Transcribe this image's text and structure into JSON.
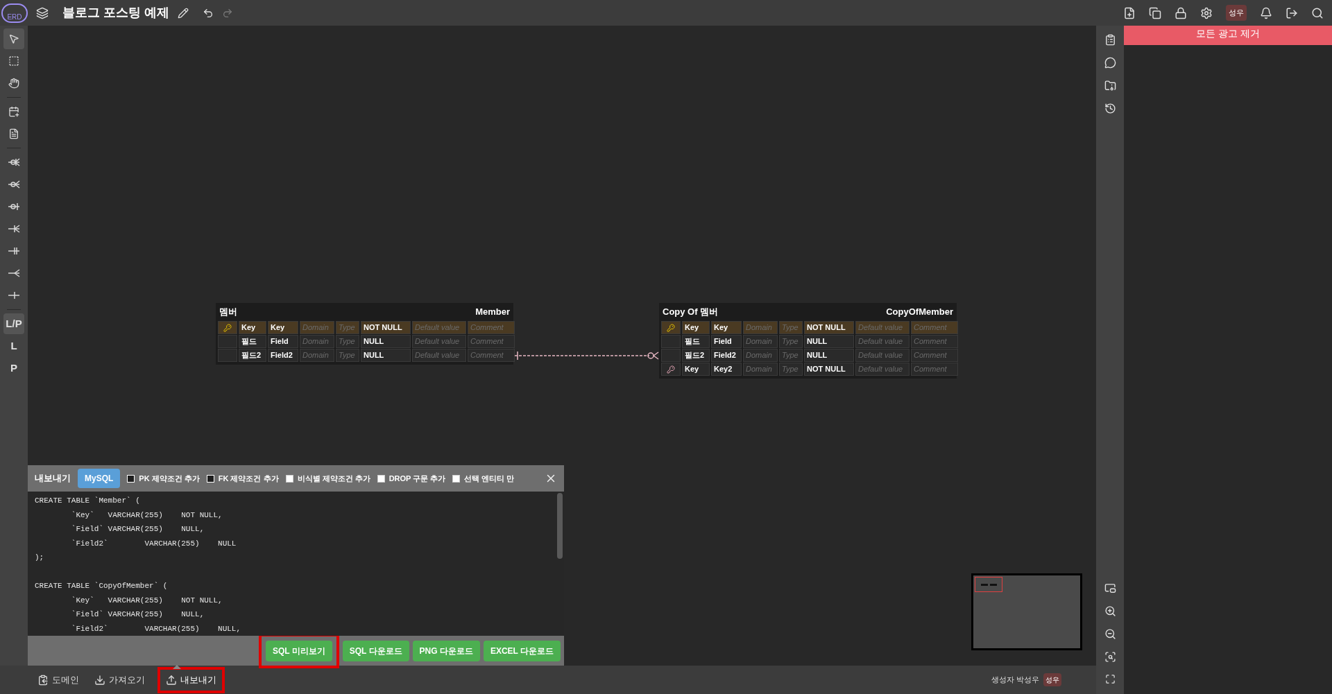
{
  "top_bar": {
    "logo": "ERD",
    "title": "블로그 포스팅 예제",
    "avatar": "성우"
  },
  "left_toolbar": [
    {
      "kind": "icon",
      "selected": true
    },
    {
      "kind": "icon",
      "selected": false
    },
    {
      "kind": "icon",
      "selected": false
    },
    {
      "kind": "icon",
      "selected": false
    },
    {
      "kind": "icon",
      "selected": false
    },
    {
      "kind": "icon",
      "selected": false
    },
    {
      "kind": "icon",
      "selected": false
    },
    {
      "kind": "icon",
      "selected": false
    },
    {
      "kind": "icon",
      "selected": false
    },
    {
      "kind": "icon",
      "selected": false
    },
    {
      "kind": "icon",
      "selected": false
    },
    {
      "kind": "icon",
      "selected": false
    },
    {
      "kind": "text",
      "label": "L/P",
      "selected": true
    },
    {
      "kind": "text",
      "label": "L",
      "selected": false
    },
    {
      "kind": "text",
      "label": "P",
      "selected": false
    }
  ],
  "tables": [
    {
      "logical_name": "멤버",
      "physical_name": "Member",
      "rows": [
        {
          "kind": "pk",
          "logical": "Key",
          "physical": "Key",
          "domain": "Domain",
          "type": "Type",
          "null": "NOT NULL",
          "default": "Default value",
          "comment": "Comment"
        },
        {
          "kind": "field",
          "logical": "필드",
          "physical": "Field",
          "domain": "Domain",
          "type": "Type",
          "null": "NULL",
          "default": "Default value",
          "comment": "Comment"
        },
        {
          "kind": "field",
          "logical": "필드2",
          "physical": "Field2",
          "domain": "Domain",
          "type": "Type",
          "null": "NULL",
          "default": "Default value",
          "comment": "Comment"
        }
      ]
    },
    {
      "logical_name": "Copy Of 멤버",
      "physical_name": "CopyOfMember",
      "rows": [
        {
          "kind": "pk",
          "logical": "Key",
          "physical": "Key",
          "domain": "Domain",
          "type": "Type",
          "null": "NOT NULL",
          "default": "Default value",
          "comment": "Comment"
        },
        {
          "kind": "field",
          "logical": "필드",
          "physical": "Field",
          "domain": "Domain",
          "type": "Type",
          "null": "NULL",
          "default": "Default value",
          "comment": "Comment"
        },
        {
          "kind": "field",
          "logical": "필드2",
          "physical": "Field2",
          "domain": "Domain",
          "type": "Type",
          "null": "NULL",
          "default": "Default value",
          "comment": "Comment"
        },
        {
          "kind": "fk",
          "logical": "Key",
          "physical": "Key2",
          "domain": "Domain",
          "type": "Type",
          "null": "NOT NULL",
          "default": "Default value",
          "comment": "Comment"
        }
      ]
    }
  ],
  "export_panel": {
    "title": "내보내기",
    "dialect": "MySQL",
    "options": [
      {
        "label": "PK 제약조건 추가",
        "checked": true
      },
      {
        "label": "FK 제약조건 추가",
        "checked": true
      },
      {
        "label": "비식별 제약조건 추가",
        "checked": false
      },
      {
        "label": "DROP 구문 추가",
        "checked": false
      },
      {
        "label": "선택 엔티티 만",
        "checked": false
      }
    ],
    "code_blocks": [
      [
        "CREATE TABLE `Member` (",
        "        `Key`   VARCHAR(255)    NOT NULL,",
        "        `Field` VARCHAR(255)    NULL,",
        "        `Field2`        VARCHAR(255)    NULL",
        ");"
      ],
      [
        "CREATE TABLE `CopyOfMember` (",
        "        `Key`   VARCHAR(255)    NOT NULL,",
        "        `Field` VARCHAR(255)    NULL,",
        "        `Field2`        VARCHAR(255)    NULL,"
      ]
    ],
    "buttons": [
      {
        "label": "SQL 미리보기",
        "highlighted": true
      },
      {
        "label": "SQL 다운로드",
        "highlighted": false
      },
      {
        "label": "PNG 다운로드",
        "highlighted": false
      },
      {
        "label": "EXCEL 다운로드",
        "highlighted": false
      }
    ]
  },
  "bottom_bar": {
    "tabs": [
      {
        "label": "도메인",
        "selected": false,
        "highlighted": false
      },
      {
        "label": "가져오기",
        "selected": false,
        "highlighted": false
      },
      {
        "label": "내보내기",
        "selected": true,
        "highlighted": true
      }
    ],
    "creator": "생성자 박성우",
    "avatar": "성우"
  },
  "ad_panel": {
    "banner": "모든 광고 제거"
  }
}
